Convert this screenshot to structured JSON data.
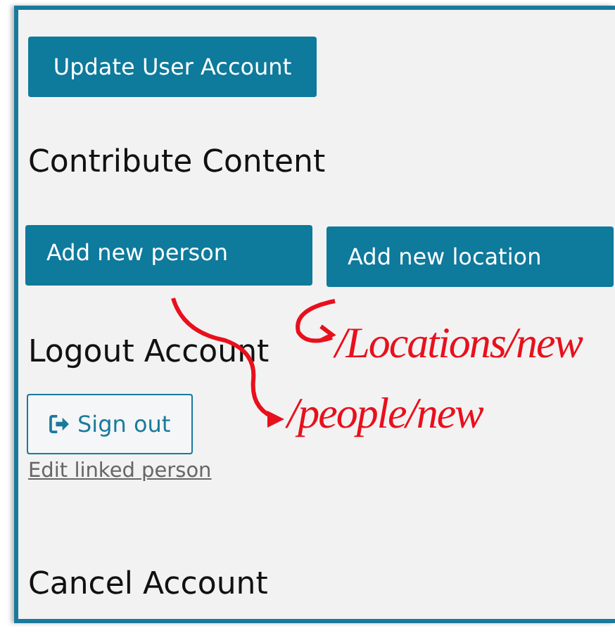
{
  "sections": [
    {
      "kind": "buttons",
      "buttons": [
        {
          "label": "Update User Account",
          "kind": "primary"
        }
      ]
    },
    {
      "kind": "heading",
      "text": "Contribute Content"
    },
    {
      "kind": "buttons",
      "buttons": [
        {
          "label": "Add new person",
          "kind": "primary"
        },
        {
          "label": "Add new location",
          "kind": "primary"
        }
      ]
    },
    {
      "kind": "heading",
      "text": "Logout Account"
    },
    {
      "kind": "buttons",
      "buttons": [
        {
          "label": "Sign out",
          "kind": "signout"
        }
      ]
    },
    {
      "kind": "link",
      "text": "Edit linked person"
    },
    {
      "kind": "heading",
      "text": "Cancel Account"
    }
  ],
  "annotations": [
    {
      "text": "/Locations/new"
    },
    {
      "text": "/people/new"
    }
  ]
}
